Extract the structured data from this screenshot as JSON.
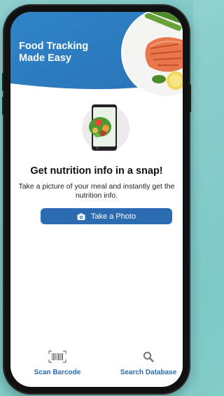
{
  "header": {
    "title": "Food Tracking\nMade Easy"
  },
  "main": {
    "headline": "Get nutrition info in a snap!",
    "subtext": "Take a picture of your meal and instantly get the nutrition info.",
    "photo_button_label": "Take a Photo"
  },
  "bottom_nav": {
    "scan_label": "Scan Barcode",
    "search_label": "Search Database"
  },
  "colors": {
    "accent": "#2b6bb2",
    "banner": "#2f7fc4",
    "background": "#8fd1cf"
  },
  "icons": {
    "header_image": "salmon-plate-image",
    "illustration": "phone-salad-icon",
    "photo_button": "camera-icon",
    "scan": "barcode-icon",
    "search": "magnifier-icon"
  }
}
